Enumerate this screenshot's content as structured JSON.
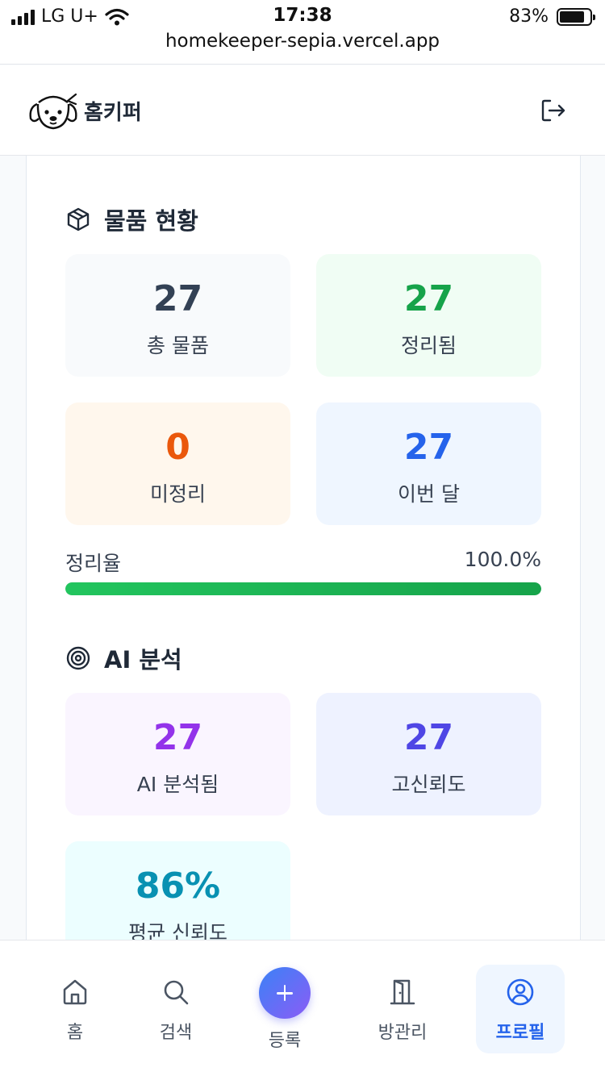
{
  "status_bar": {
    "carrier": "LG U+",
    "time": "17:38",
    "battery": "83%",
    "battery_level": 0.83,
    "url": "homekeeper-sepia.vercel.app"
  },
  "header": {
    "title": "홈키퍼",
    "logo_icon": "dog-logo-icon",
    "logout_icon": "logout-icon"
  },
  "items_section": {
    "title": "물품 현황",
    "icon": "box-icon",
    "stats": [
      {
        "value": "27",
        "label": "총 물품",
        "color": "#334155",
        "bg": "#f8fafc"
      },
      {
        "value": "27",
        "label": "정리됨",
        "color": "#16a34a",
        "bg": "#f0fdf4"
      },
      {
        "value": "0",
        "label": "미정리",
        "color": "#ea580c",
        "bg": "#fff7ed"
      },
      {
        "value": "27",
        "label": "이번 달",
        "color": "#2563eb",
        "bg": "#eff6ff"
      }
    ],
    "rate": {
      "label": "정리율",
      "value": "100.0%",
      "fraction": 1.0
    }
  },
  "ai_section": {
    "title": "AI 분석",
    "icon": "target-icon",
    "stats": [
      {
        "value": "27",
        "label": "AI 분석됨",
        "color": "#9333ea",
        "bg": "#faf5ff"
      },
      {
        "value": "27",
        "label": "고신뢰도",
        "color": "#4f46e5",
        "bg": "#eef2ff"
      },
      {
        "value": "86%",
        "label": "평균 신뢰도",
        "color": "#0891b2",
        "bg": "#ecfeff"
      }
    ]
  },
  "bottom_nav": {
    "items": [
      {
        "label": "홈",
        "icon": "home-icon"
      },
      {
        "label": "검색",
        "icon": "search-icon"
      },
      {
        "label": "등록",
        "icon": "plus-icon"
      },
      {
        "label": "방관리",
        "icon": "door-icon"
      },
      {
        "label": "프로필",
        "icon": "user-circle-icon",
        "active": true
      }
    ]
  }
}
